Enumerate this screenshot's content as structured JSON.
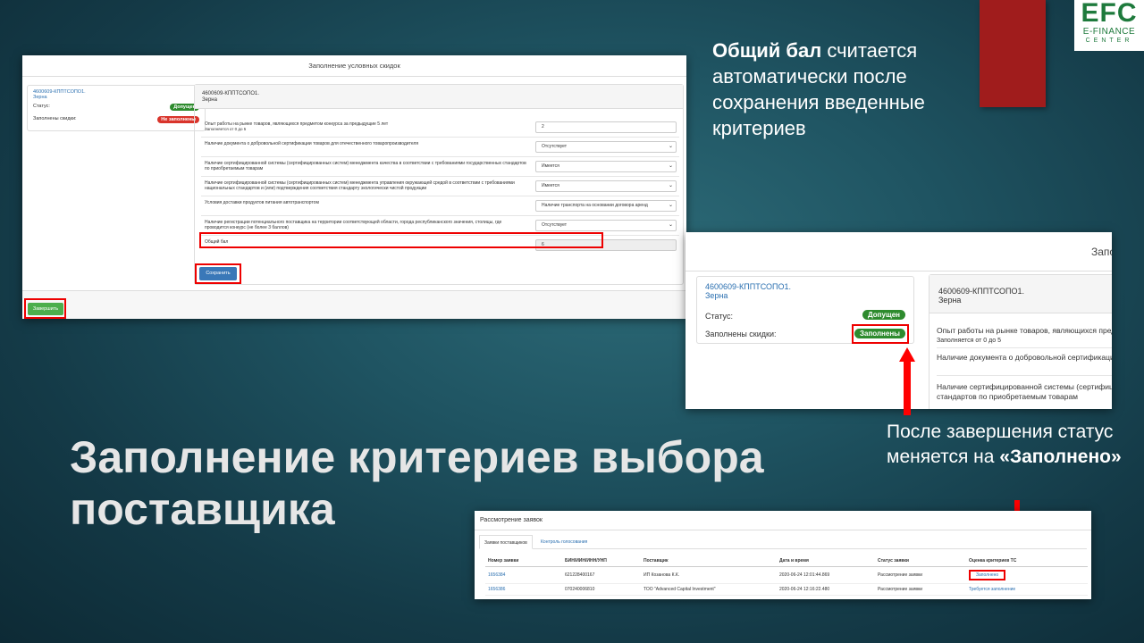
{
  "logo": {
    "big": "EFC",
    "line1": "E-FINANCE",
    "line2": "CENTER"
  },
  "note_top": {
    "bold": "Общий бал",
    "rest": " считается автоматически после сохранения введенные критериев"
  },
  "note_mid": {
    "text": "После завершения статус меняется на ",
    "bold": "«Заполнено»"
  },
  "slide_title": "Заполнение критериев выбора поставщика",
  "shot1": {
    "header": "Заполнение условных скидок",
    "left": {
      "code": "4600609-КППТСОПО1.",
      "name": "Зерна",
      "status_label": "Статус:",
      "status_value": "Допущен",
      "discount_label": "Заполнены скидки:",
      "discount_value": "Не заполнены"
    },
    "right_head": {
      "code": "4600609-КППТСОПО1.",
      "name": "Зерна"
    },
    "rows": [
      {
        "text": "Опыт работы на рынке товаров, являющихся предметом конкурса за предыдущие 5 лет",
        "sub": "Заполняется от 0 до 5",
        "value": "2",
        "select": false
      },
      {
        "text": "Наличие документа о добровольной сертификации товаров для отечественного товаропроизводителя",
        "sub": "",
        "value": "Отсутствует",
        "select": true
      },
      {
        "text": "Наличие сертифицированной системы (сертифицированных систем) менеджмента качества в соответствии с требованиями государственных стандартов по приобретаемым товарам",
        "sub": "",
        "value": "Имеется",
        "select": true
      },
      {
        "text": "Наличие сертифицированной системы (сертифицированных систем) менеджмента управления окружающей средой в соответствии с требованиями национальных стандартов и (или) подтверждения соответствия стандарту экологически чистой продукции",
        "sub": "",
        "value": "Имеется",
        "select": true
      },
      {
        "text": "Условия доставки продуктов питания автотранспортом",
        "sub": "",
        "value": "Наличие транспорта на основании договора аренд",
        "select": true
      },
      {
        "text": "Наличие регистрации потенциального поставщика на территории соответствующей области, города республиканского значения, столицы, где проводится конкурс (не более 3 баллов)",
        "sub": "",
        "value": "Отсутствует",
        "select": true
      }
    ],
    "total_label": "Общий бал",
    "total_value": "6",
    "save_button": "Сохранить",
    "finish_button": "Завершить"
  },
  "shot2": {
    "header": "Запол",
    "left": {
      "code": "4600609-КППТСОПО1.",
      "name": "Зерна",
      "status_label": "Статус:",
      "status_value": "Допущен",
      "discount_label": "Заполнены скидки:",
      "discount_value": "Заполнены"
    },
    "right_head": {
      "code": "4600609-КППТСОПО1.",
      "name": "Зерна"
    },
    "rows": [
      {
        "text": "Опыт работы на рынке товаров, являющихся предмет",
        "sub": "Заполняется от 0 до 5"
      },
      {
        "text": "Наличие документа о добровольной сертификации то",
        "sub": ""
      },
      {
        "text": "Наличие сертифицированной системы (сертифициров",
        "sub": "стандартов по приобретаемым товарам"
      }
    ]
  },
  "shot3": {
    "header": "Рассмотрение заявок",
    "tabs": [
      "Заявки поставщиков",
      "Контроль голосования"
    ],
    "columns": [
      "Номер заявки",
      "БИН/ИИН/ИНН/УНП",
      "Поставщик",
      "Дата и время",
      "Статус заявки",
      "Оценка критериев ТС"
    ],
    "rows": [
      {
        "number": "1656384",
        "bin": "621228400167",
        "supplier": "ИП Козанова К.К.",
        "date": "2020-06-24 12:01:44.869",
        "status": "Рассмотрение заявки",
        "assessment": "Заполнено"
      },
      {
        "number": "1656386",
        "bin": "070240006810",
        "supplier": "ТОО \"Advanced Capital Investment\"",
        "date": "2020-06-24 12:16:22.480",
        "status": "Рассмотрение заявки",
        "assessment": "Требуется заполнение"
      }
    ]
  },
  "colors": {
    "ribbon": "#a01c1c",
    "logo_green": "#1e7a3c",
    "highlight_red": "#ff0000",
    "badge_green": "#2e8b2e",
    "badge_red": "#d9342b"
  }
}
